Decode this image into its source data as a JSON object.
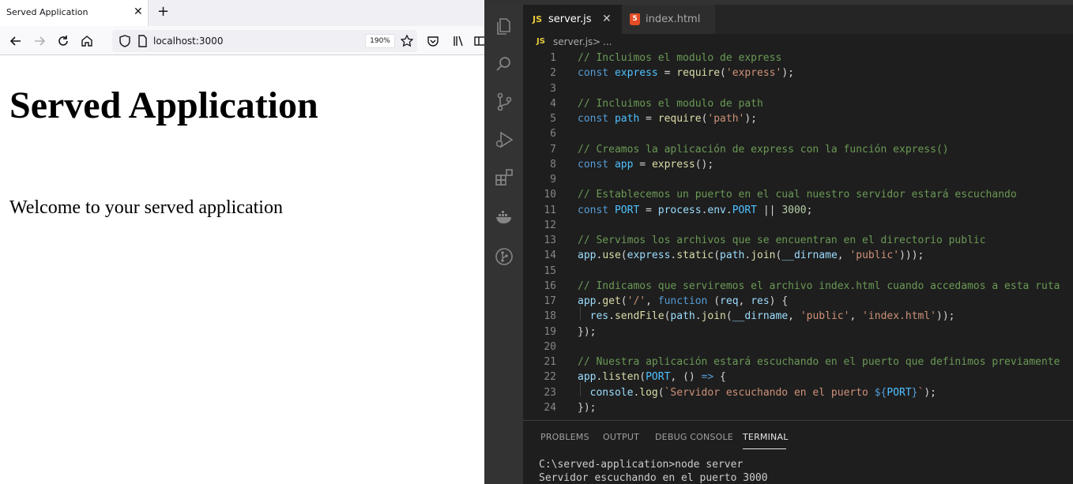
{
  "browser": {
    "tab_title": "Served Application",
    "tab_close": "✕",
    "new_tab": "+",
    "url": "localhost:3000",
    "zoom": "190%",
    "page": {
      "heading": "Served Application",
      "paragraph": "Welcome to your served application"
    }
  },
  "editor": {
    "tabs": [
      {
        "badge": "JS",
        "label": "server.js",
        "close": "✕"
      },
      {
        "badge": "5",
        "label": "index.html"
      }
    ],
    "breadcrumb": {
      "badge": "JS",
      "file": "server.js",
      "separator": ">",
      "more": "..."
    },
    "code_lines": [
      {
        "n": "1",
        "tokens": [
          [
            "c",
            "// Incluimos el modulo de express"
          ]
        ]
      },
      {
        "n": "2",
        "tokens": [
          [
            "k",
            "const"
          ],
          [
            "o",
            " "
          ],
          [
            "cv",
            "express"
          ],
          [
            "o",
            " = "
          ],
          [
            "f",
            "require"
          ],
          [
            "o",
            "("
          ],
          [
            "s",
            "'express'"
          ],
          [
            "o",
            ");"
          ]
        ]
      },
      {
        "n": "3",
        "tokens": []
      },
      {
        "n": "4",
        "tokens": [
          [
            "c",
            "// Incluimos el modulo de path"
          ]
        ]
      },
      {
        "n": "5",
        "tokens": [
          [
            "k",
            "const"
          ],
          [
            "o",
            " "
          ],
          [
            "cv",
            "path"
          ],
          [
            "o",
            " = "
          ],
          [
            "f",
            "require"
          ],
          [
            "o",
            "("
          ],
          [
            "s",
            "'path'"
          ],
          [
            "o",
            ");"
          ]
        ]
      },
      {
        "n": "6",
        "tokens": []
      },
      {
        "n": "7",
        "tokens": [
          [
            "c",
            "// Creamos la aplicación de express con la función express()"
          ]
        ]
      },
      {
        "n": "8",
        "tokens": [
          [
            "k",
            "const"
          ],
          [
            "o",
            " "
          ],
          [
            "cv",
            "app"
          ],
          [
            "o",
            " = "
          ],
          [
            "f",
            "express"
          ],
          [
            "o",
            "();"
          ]
        ]
      },
      {
        "n": "9",
        "tokens": []
      },
      {
        "n": "10",
        "tokens": [
          [
            "c",
            "// Establecemos un puerto en el cual nuestro servidor estará escuchando"
          ]
        ]
      },
      {
        "n": "11",
        "tokens": [
          [
            "k",
            "const"
          ],
          [
            "o",
            " "
          ],
          [
            "cv",
            "PORT"
          ],
          [
            "o",
            " = "
          ],
          [
            "v",
            "process"
          ],
          [
            "o",
            "."
          ],
          [
            "v",
            "env"
          ],
          [
            "o",
            "."
          ],
          [
            "cv",
            "PORT"
          ],
          [
            "o",
            " || "
          ],
          [
            "n",
            "3000"
          ],
          [
            "o",
            ";"
          ]
        ]
      },
      {
        "n": "12",
        "tokens": []
      },
      {
        "n": "13",
        "tokens": [
          [
            "c",
            "// Servimos los archivos que se encuentran en el directorio public"
          ]
        ]
      },
      {
        "n": "14",
        "tokens": [
          [
            "v",
            "app"
          ],
          [
            "o",
            "."
          ],
          [
            "f",
            "use"
          ],
          [
            "o",
            "("
          ],
          [
            "v",
            "express"
          ],
          [
            "o",
            "."
          ],
          [
            "f",
            "static"
          ],
          [
            "o",
            "("
          ],
          [
            "v",
            "path"
          ],
          [
            "o",
            "."
          ],
          [
            "f",
            "join"
          ],
          [
            "o",
            "("
          ],
          [
            "v",
            "__dirname"
          ],
          [
            "o",
            ", "
          ],
          [
            "s",
            "'public'"
          ],
          [
            "o",
            ")));"
          ]
        ]
      },
      {
        "n": "15",
        "tokens": []
      },
      {
        "n": "16",
        "tokens": [
          [
            "c",
            "// Indicamos que serviremos el archivo index.html cuando accedamos a esta ruta"
          ]
        ]
      },
      {
        "n": "17",
        "tokens": [
          [
            "v",
            "app"
          ],
          [
            "o",
            "."
          ],
          [
            "f",
            "get"
          ],
          [
            "o",
            "("
          ],
          [
            "s",
            "'/'"
          ],
          [
            "o",
            ", "
          ],
          [
            "k",
            "function"
          ],
          [
            "o",
            " ("
          ],
          [
            "v",
            "req"
          ],
          [
            "o",
            ", "
          ],
          [
            "v",
            "res"
          ],
          [
            "o",
            ") {"
          ]
        ]
      },
      {
        "n": "18",
        "tokens": [
          [
            "o",
            "  "
          ],
          [
            "v",
            "res"
          ],
          [
            "o",
            "."
          ],
          [
            "f",
            "sendFile"
          ],
          [
            "o",
            "("
          ],
          [
            "v",
            "path"
          ],
          [
            "o",
            "."
          ],
          [
            "f",
            "join"
          ],
          [
            "o",
            "("
          ],
          [
            "v",
            "__dirname"
          ],
          [
            "o",
            ", "
          ],
          [
            "s",
            "'public'"
          ],
          [
            "o",
            ", "
          ],
          [
            "s",
            "'index.html'"
          ],
          [
            "o",
            "));"
          ]
        ]
      },
      {
        "n": "19",
        "tokens": [
          [
            "o",
            "});"
          ]
        ]
      },
      {
        "n": "20",
        "tokens": []
      },
      {
        "n": "21",
        "tokens": [
          [
            "c",
            "// Nuestra aplicación estará escuchando en el puerto que definimos previamente"
          ]
        ]
      },
      {
        "n": "22",
        "tokens": [
          [
            "v",
            "app"
          ],
          [
            "o",
            "."
          ],
          [
            "f",
            "listen"
          ],
          [
            "o",
            "("
          ],
          [
            "cv",
            "PORT"
          ],
          [
            "o",
            ", () "
          ],
          [
            "k",
            "=>"
          ],
          [
            "o",
            " {"
          ]
        ]
      },
      {
        "n": "23",
        "tokens": [
          [
            "o",
            "  "
          ],
          [
            "v",
            "console"
          ],
          [
            "o",
            "."
          ],
          [
            "f",
            "log"
          ],
          [
            "o",
            "("
          ],
          [
            "s",
            "`Servidor escuchando en el puerto "
          ],
          [
            "k",
            "${"
          ],
          [
            "cv",
            "PORT"
          ],
          [
            "k",
            "}"
          ],
          [
            "s",
            "`"
          ],
          [
            "o",
            ");"
          ]
        ]
      },
      {
        "n": "24",
        "tokens": [
          [
            "o",
            "});"
          ]
        ]
      }
    ]
  },
  "panel": {
    "tabs": [
      "PROBLEMS",
      "OUTPUT",
      "DEBUG CONSOLE",
      "TERMINAL"
    ],
    "active_tab": "TERMINAL",
    "terminal_lines": [
      "C:\\served-application>node server",
      "Servidor escuchando en el puerto 3000"
    ]
  },
  "colors": {
    "editor_bg": "#1e1e1e",
    "activity_bar": "#333333",
    "comment": "#6a9955",
    "keyword": "#569cd6",
    "string": "#ce9178",
    "function": "#dcdcaa",
    "variable": "#9cdcfe",
    "constant": "#4fc1ff",
    "number": "#b5cea8",
    "js_badge": "#e8c93a",
    "html_badge": "#e44d26"
  },
  "icons": {
    "browser": [
      "back-arrow-icon",
      "forward-arrow-icon",
      "reload-icon",
      "home-icon",
      "shield-icon",
      "page-icon",
      "star-icon",
      "pocket-icon",
      "library-icon",
      "sidebar-icon"
    ],
    "activity_bar": [
      "files-icon",
      "search-icon",
      "source-control-icon",
      "run-debug-icon",
      "extensions-icon",
      "docker-icon",
      "git-graph-icon"
    ]
  }
}
